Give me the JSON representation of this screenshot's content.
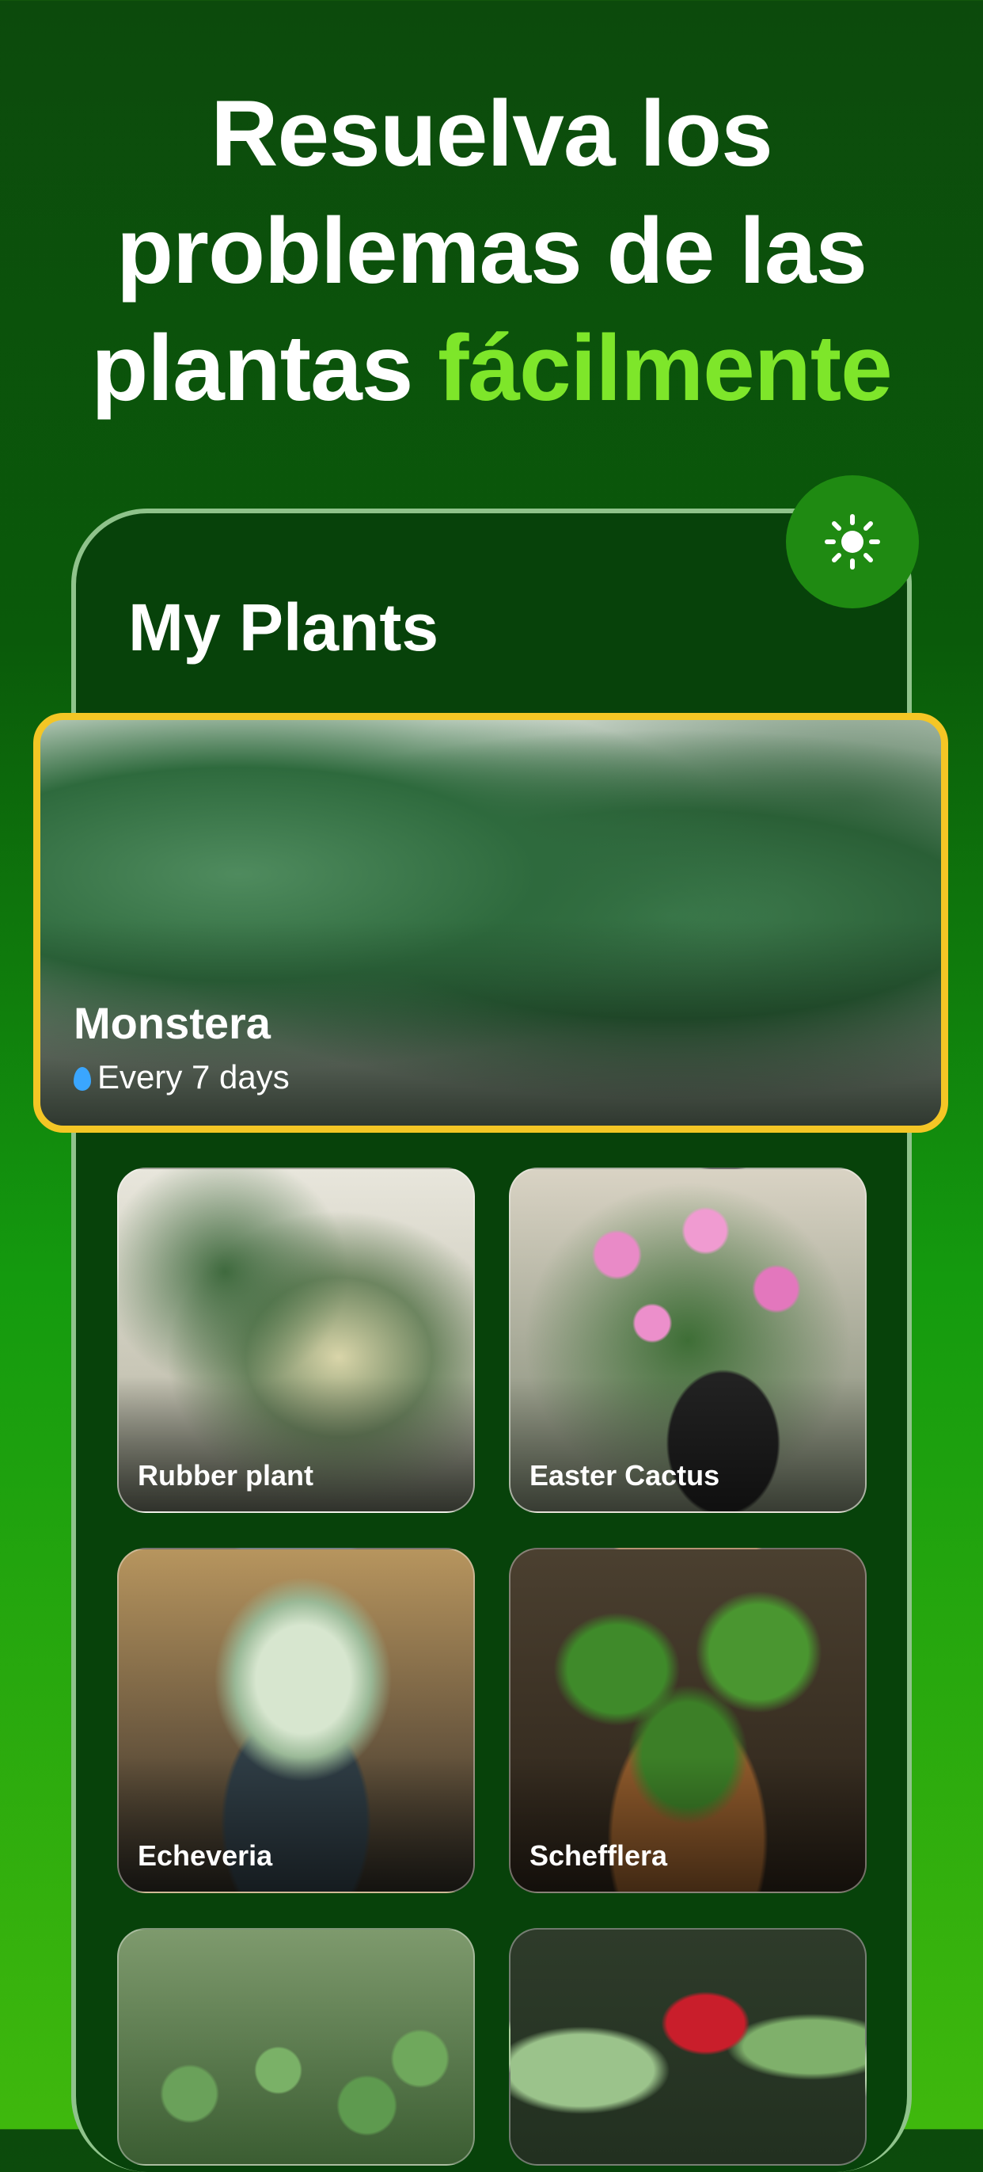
{
  "headline": {
    "line1": "Resuelva los",
    "line2": "problemas de las",
    "line3_plain": "plantas",
    "line3_accent": "fácilmente"
  },
  "phone": {
    "title": "My Plants",
    "theme_icon": "sun-icon"
  },
  "featured_plant": {
    "name": "Monstera",
    "watering_icon": "water-drop-icon",
    "watering": "Every 7 days"
  },
  "plants": [
    {
      "name": "Rubber plant"
    },
    {
      "name": "Easter Cactus"
    },
    {
      "name": "Echeveria"
    },
    {
      "name": "Schefflera"
    },
    {
      "name": ""
    },
    {
      "name": ""
    }
  ],
  "colors": {
    "accent": "#7ee62a",
    "highlight_border": "#f4c625",
    "theme_button": "#1f8a12"
  }
}
